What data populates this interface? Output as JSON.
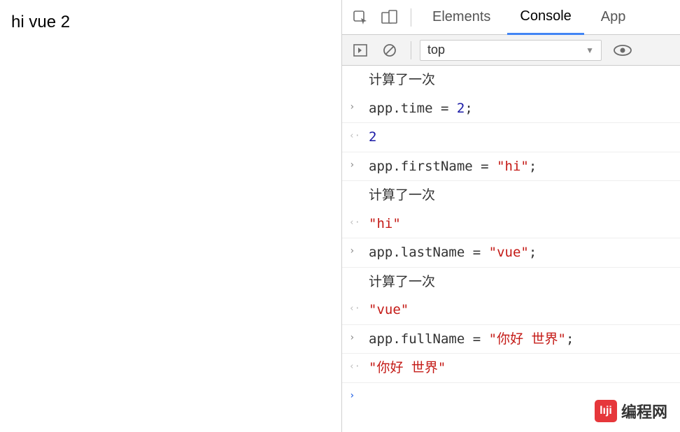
{
  "page": {
    "content": "hi vue 2"
  },
  "devtools": {
    "tabs": {
      "elements": "Elements",
      "console": "Console",
      "application": "App"
    },
    "context_select": "top"
  },
  "console": {
    "rows": [
      {
        "type": "log",
        "text": "计算了一次"
      },
      {
        "type": "input",
        "tokens": [
          {
            "t": "obj",
            "v": "app"
          },
          {
            "t": "op",
            "v": "."
          },
          {
            "t": "prop",
            "v": "time"
          },
          {
            "t": "op",
            "v": " = "
          },
          {
            "t": "num",
            "v": "2"
          },
          {
            "t": "op",
            "v": ";"
          }
        ]
      },
      {
        "type": "return",
        "tokens": [
          {
            "t": "num",
            "v": "2"
          }
        ]
      },
      {
        "type": "input",
        "tokens": [
          {
            "t": "obj",
            "v": "app"
          },
          {
            "t": "op",
            "v": "."
          },
          {
            "t": "prop",
            "v": "firstName"
          },
          {
            "t": "op",
            "v": " = "
          },
          {
            "t": "str",
            "v": "\"hi\""
          },
          {
            "t": "op",
            "v": ";"
          }
        ]
      },
      {
        "type": "log",
        "text": "计算了一次"
      },
      {
        "type": "return",
        "tokens": [
          {
            "t": "str",
            "v": "\"hi\""
          }
        ]
      },
      {
        "type": "input",
        "tokens": [
          {
            "t": "obj",
            "v": "app"
          },
          {
            "t": "op",
            "v": "."
          },
          {
            "t": "prop",
            "v": "lastName"
          },
          {
            "t": "op",
            "v": " = "
          },
          {
            "t": "str",
            "v": "\"vue\""
          },
          {
            "t": "op",
            "v": ";"
          }
        ]
      },
      {
        "type": "log",
        "text": "计算了一次"
      },
      {
        "type": "return",
        "tokens": [
          {
            "t": "str",
            "v": "\"vue\""
          }
        ]
      },
      {
        "type": "input",
        "tokens": [
          {
            "t": "obj",
            "v": "app"
          },
          {
            "t": "op",
            "v": "."
          },
          {
            "t": "prop",
            "v": "fullName"
          },
          {
            "t": "op",
            "v": " = "
          },
          {
            "t": "str",
            "v": "\"你好 世界\""
          },
          {
            "t": "op",
            "v": ";"
          }
        ]
      },
      {
        "type": "return",
        "tokens": [
          {
            "t": "str",
            "v": "\"你好 世界\""
          }
        ]
      },
      {
        "type": "prompt"
      }
    ]
  },
  "watermark": {
    "logo_text": "lıji",
    "text": "编程网"
  }
}
